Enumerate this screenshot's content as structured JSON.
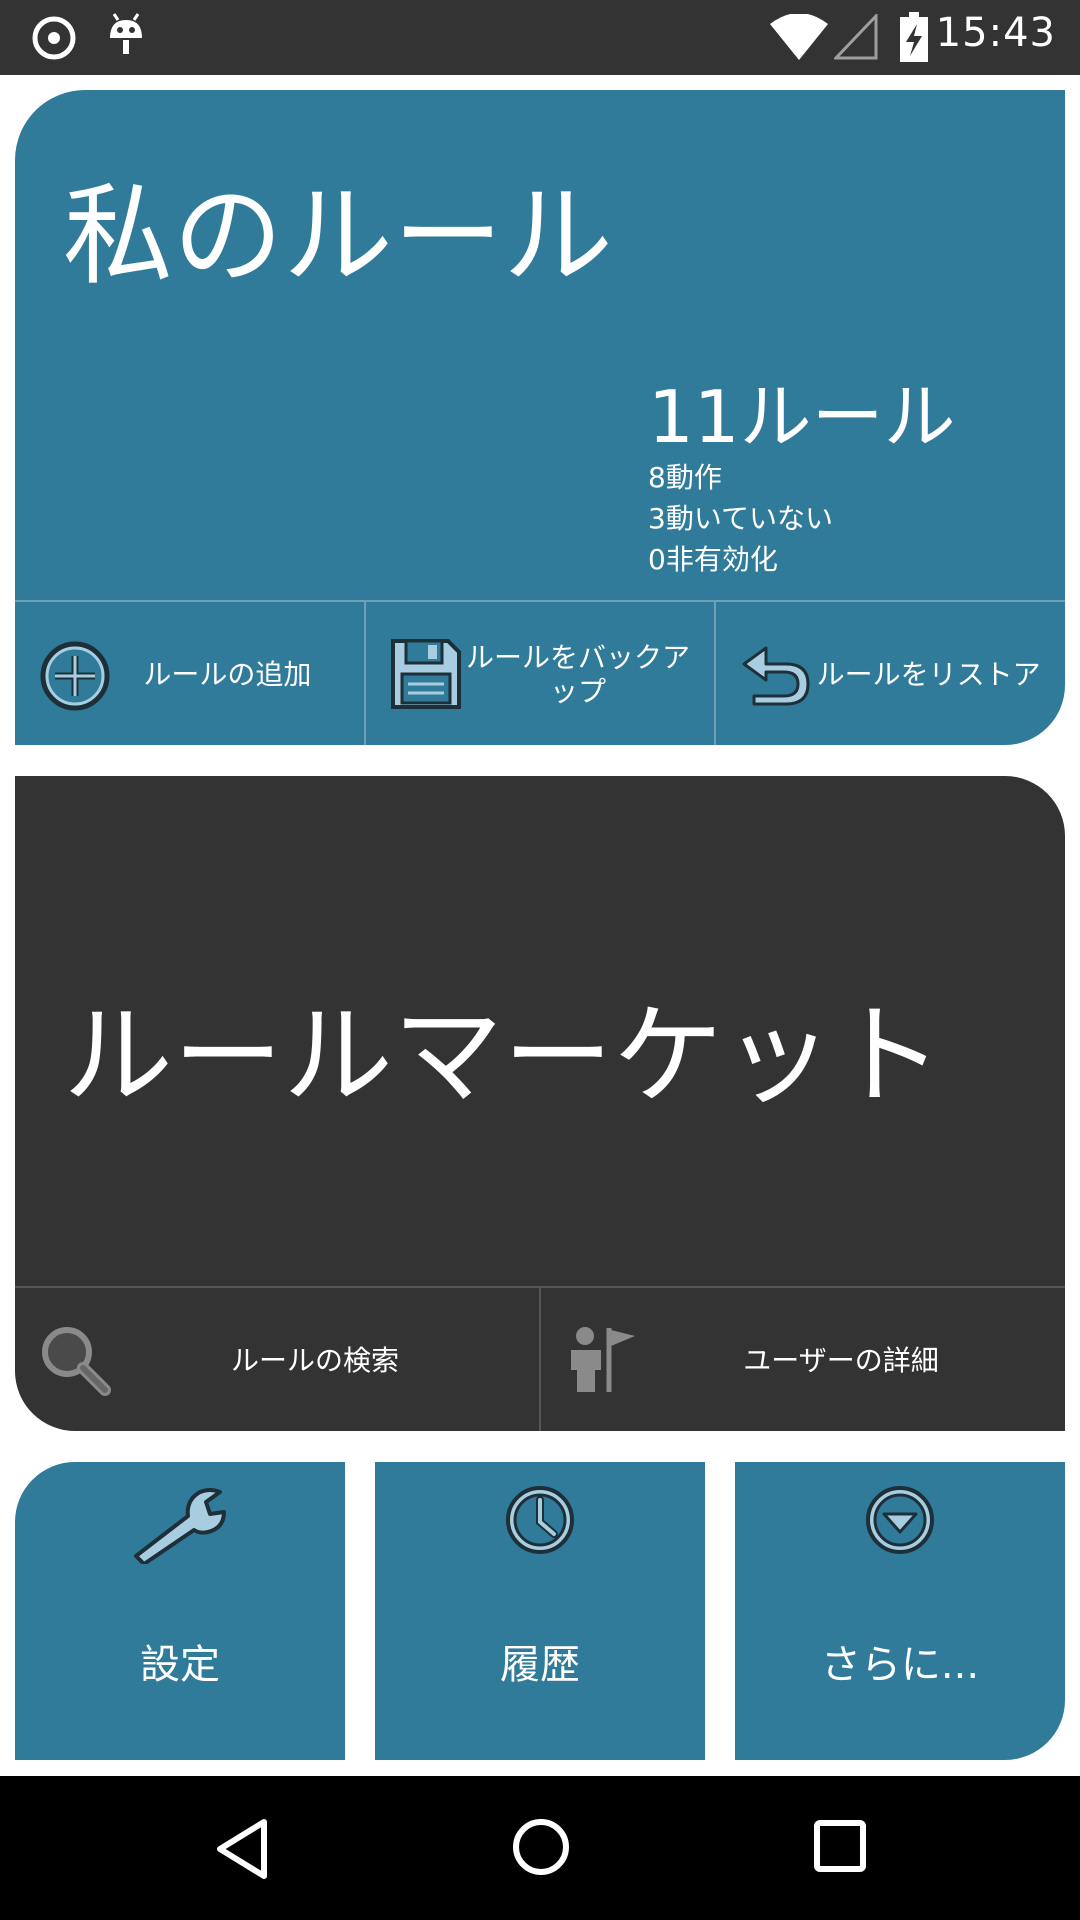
{
  "status_bar": {
    "time": "15:43",
    "icons": [
      "record-icon",
      "android-icon",
      "wifi-icon",
      "signal-icon",
      "battery-charging-icon"
    ]
  },
  "my_rules": {
    "title": "私のルール",
    "count": "11ルール",
    "stats": [
      "8動作",
      "3動いていない",
      "0非有効化"
    ],
    "actions": [
      {
        "label": "ルールの追加",
        "icon": "add-circle-icon"
      },
      {
        "label": "ルールをバックアップ",
        "icon": "floppy-disk-icon"
      },
      {
        "label": "ルールをリストア",
        "icon": "undo-arrow-icon"
      }
    ]
  },
  "market": {
    "title": "ルールマーケット",
    "actions": [
      {
        "label": "ルールの検索",
        "icon": "magnifier-icon"
      },
      {
        "label": "ユーザーの詳細",
        "icon": "user-flag-icon"
      }
    ]
  },
  "tiles": [
    {
      "label": "設定",
      "icon": "wrench-icon"
    },
    {
      "label": "履歴",
      "icon": "clock-icon"
    },
    {
      "label": "さらに...",
      "icon": "dropdown-circle-icon"
    }
  ],
  "colors": {
    "accent": "#317b9a",
    "dark_card": "#333333",
    "status_bar": "#333333",
    "icon_fill": "#a9cde0"
  },
  "nav_bar": [
    "back-icon",
    "home-icon",
    "recents-icon"
  ]
}
